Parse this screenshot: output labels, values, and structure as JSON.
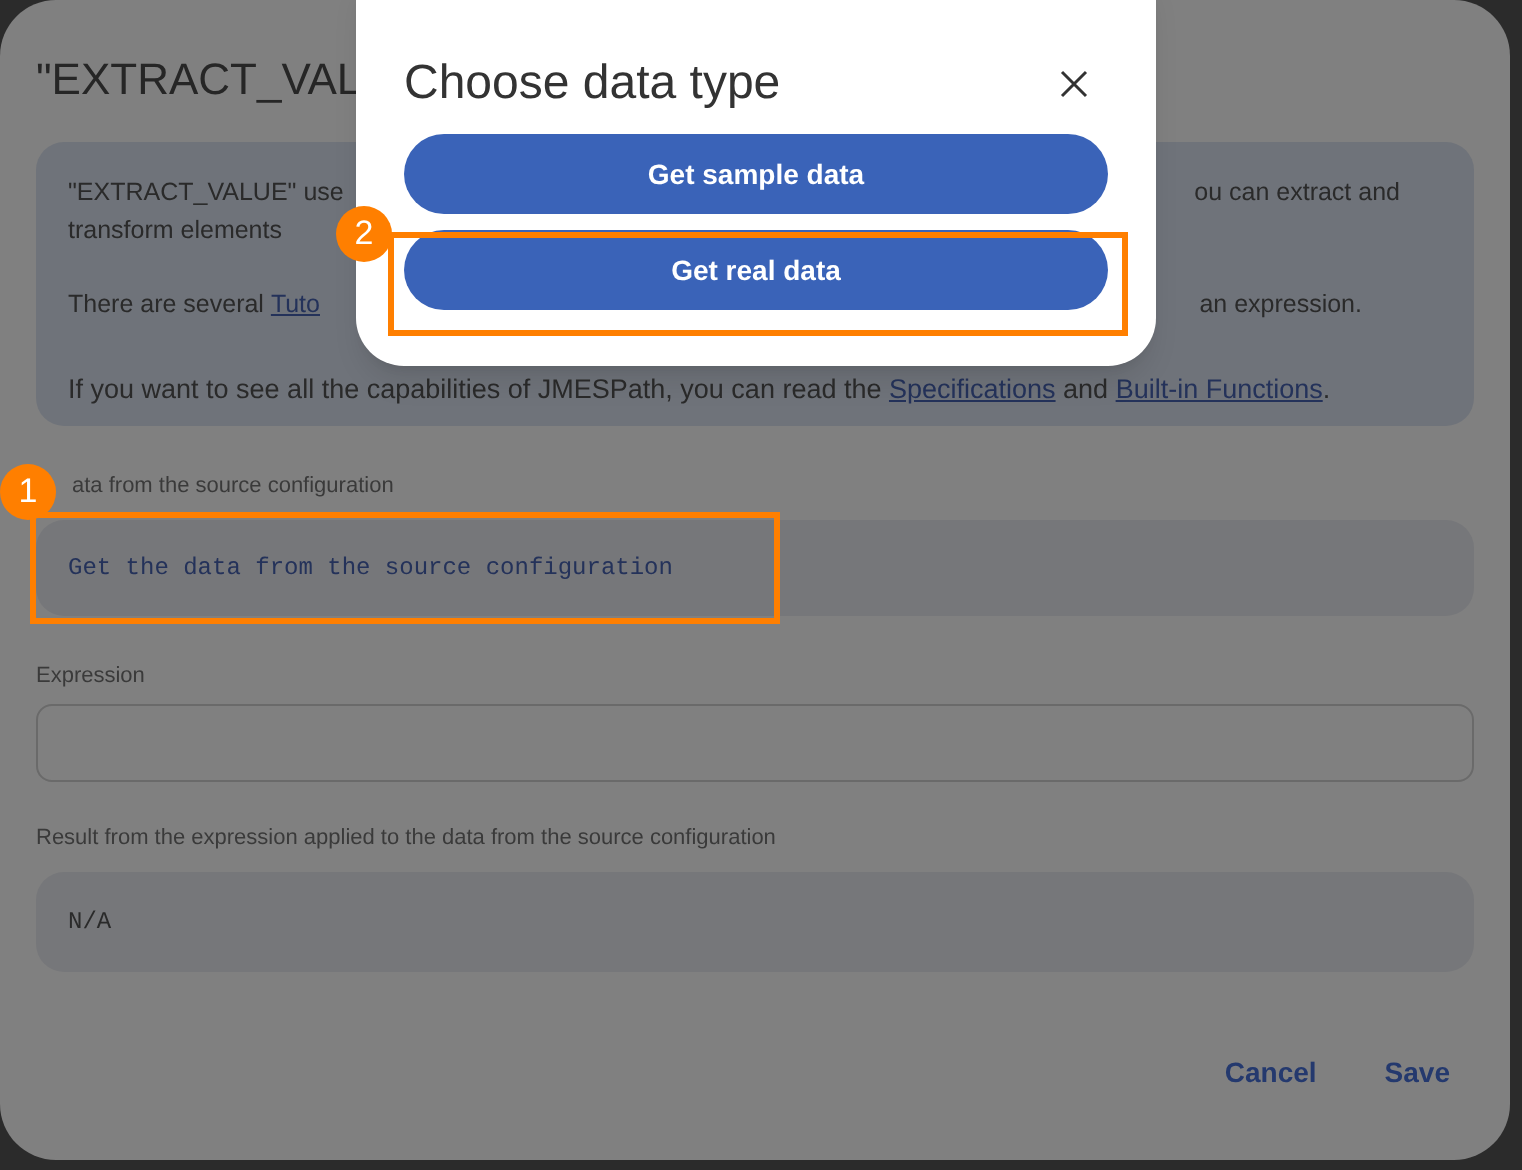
{
  "dialog": {
    "title": "\"EXTRACT_VAL",
    "info": {
      "line_1_left": "\"EXTRACT_VALUE\" use",
      "line_1_right": "ou can extract and",
      "line_2": "transform elements",
      "line_3_left": "There are several ",
      "line_3_link": "Tuto",
      "line_3_right": "an expression.",
      "line_4_before": "If you want to see all the capabilities of JMESPath, you can read the ",
      "line_4_link_1": "Specifications",
      "line_4_middle": " and ",
      "line_4_link_2": "Built-in Functions",
      "line_4_after": "."
    },
    "source_label": "ata from the source configuration",
    "source_value": "Get the data from the source configuration",
    "expression_label": "Expression",
    "result_label": "Result from the expression applied to the data from the source configuration",
    "result_value": "N/A",
    "buttons": [
      "Cancel",
      "Save"
    ]
  },
  "popup": {
    "title": "Choose data type",
    "buttons": [
      "Get sample data",
      "Get real data"
    ]
  },
  "annotations": [
    {
      "number": "1"
    },
    {
      "number": "2"
    }
  ]
}
